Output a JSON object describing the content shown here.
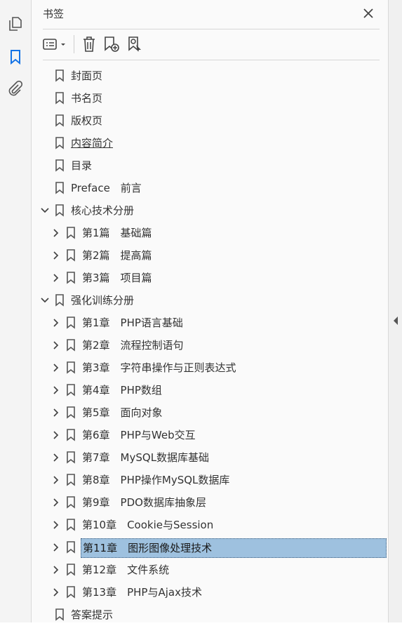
{
  "panel": {
    "title": "书签"
  },
  "rail": {
    "items": [
      {
        "name": "pages-icon"
      },
      {
        "name": "bookmark-icon"
      },
      {
        "name": "attachment-icon"
      }
    ]
  },
  "toolbar": {
    "options_icon": "list-options-icon",
    "delete_icon": "trash-icon",
    "new_bookmark_icon": "add-bookmark-icon",
    "new_from_selection_icon": "bookmark-selection-icon"
  },
  "bookmarks": [
    {
      "label": "封面页",
      "level": 0,
      "toggle": "none"
    },
    {
      "label": "书名页",
      "level": 0,
      "toggle": "none"
    },
    {
      "label": "版权页",
      "level": 0,
      "toggle": "none"
    },
    {
      "label": "内容简介",
      "level": 0,
      "toggle": "none",
      "underline": true
    },
    {
      "label": "目录",
      "level": 0,
      "toggle": "none"
    },
    {
      "label": "Preface　前言",
      "level": 0,
      "toggle": "none"
    },
    {
      "label": "核心技术分册",
      "level": 0,
      "toggle": "expanded"
    },
    {
      "label": "第1篇　基础篇",
      "level": 1,
      "toggle": "collapsed"
    },
    {
      "label": "第2篇　提高篇",
      "level": 1,
      "toggle": "collapsed"
    },
    {
      "label": "第3篇　项目篇",
      "level": 1,
      "toggle": "collapsed"
    },
    {
      "label": "强化训练分册",
      "level": 0,
      "toggle": "expanded"
    },
    {
      "label": "第1章　PHP语言基础",
      "level": 1,
      "toggle": "collapsed"
    },
    {
      "label": "第2章　流程控制语句",
      "level": 1,
      "toggle": "collapsed"
    },
    {
      "label": "第3章　字符串操作与正则表达式",
      "level": 1,
      "toggle": "collapsed"
    },
    {
      "label": "第4章　PHP数组",
      "level": 1,
      "toggle": "collapsed"
    },
    {
      "label": "第5章　面向对象",
      "level": 1,
      "toggle": "collapsed"
    },
    {
      "label": "第6章　PHP与Web交互",
      "level": 1,
      "toggle": "collapsed"
    },
    {
      "label": "第7章　MySQL数据库基础",
      "level": 1,
      "toggle": "collapsed"
    },
    {
      "label": "第8章　PHP操作MySQL数据库",
      "level": 1,
      "toggle": "collapsed"
    },
    {
      "label": "第9章　PDO数据库抽象层",
      "level": 1,
      "toggle": "collapsed"
    },
    {
      "label": "第10章　Cookie与Session",
      "level": 1,
      "toggle": "collapsed"
    },
    {
      "label": "第11章　图形图像处理技术",
      "level": 1,
      "toggle": "collapsed",
      "selected": true
    },
    {
      "label": "第12章　文件系统",
      "level": 1,
      "toggle": "collapsed"
    },
    {
      "label": "第13章　PHP与Ajax技术",
      "level": 1,
      "toggle": "collapsed"
    },
    {
      "label": "答案提示",
      "level": 0,
      "toggle": "none"
    }
  ],
  "colors": {
    "selection": "#9ec1df",
    "accent": "#1473e6"
  }
}
